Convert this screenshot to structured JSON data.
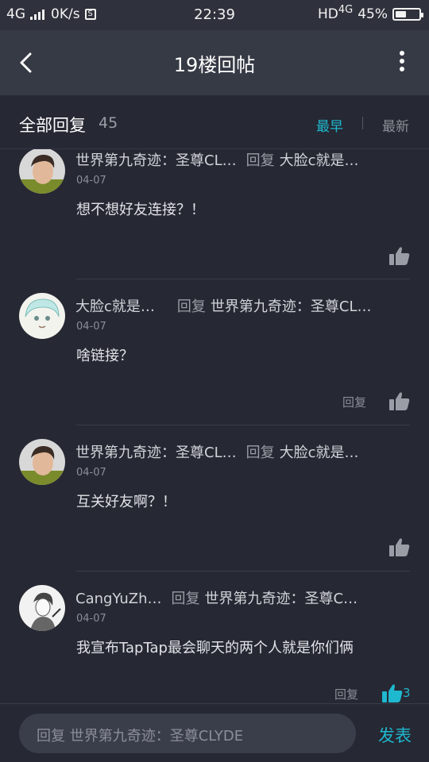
{
  "status_bar": {
    "network": "4G",
    "speed": "0K/s",
    "time": "22:39",
    "hd": "HD",
    "network_right": "4G",
    "battery": "45%",
    "battery_level": 0.45
  },
  "nav": {
    "title": "19楼回帖"
  },
  "header": {
    "title": "全部回复",
    "count": "45",
    "sort_earliest": "最早",
    "sort_newest": "最新",
    "accent_color": "#1eb8cf"
  },
  "replies": [
    {
      "author": "世界第九奇迹：圣尊CL…",
      "reply_label": "回复",
      "reply_to": "大脸c就是…",
      "date": "04-07",
      "content": "想不想好友连接？！",
      "show_reply": false,
      "like_count": ""
    },
    {
      "author": "大脸c就是…",
      "reply_label": "回复",
      "reply_to": "世界第九奇迹：圣尊CL…",
      "date": "04-07",
      "content": "啥链接？",
      "show_reply": true,
      "reply_btn": "回复",
      "like_count": ""
    },
    {
      "author": "世界第九奇迹：圣尊CL…",
      "reply_label": "回复",
      "reply_to": "大脸c就是…",
      "date": "04-07",
      "content": "互关好友啊？！",
      "show_reply": false,
      "like_count": ""
    },
    {
      "author": "CangYuZh…",
      "reply_label": "回复",
      "reply_to": "世界第九奇迹：圣尊C…",
      "date": "04-07",
      "content": "我宣布TapTap最会聊天的两个人就是你们俩",
      "show_reply": true,
      "reply_btn": "回复",
      "like_count": "3"
    }
  ],
  "bottom": {
    "input_placeholder": "回复 世界第九奇迹：圣尊CLYDE",
    "send_label": "发表"
  }
}
